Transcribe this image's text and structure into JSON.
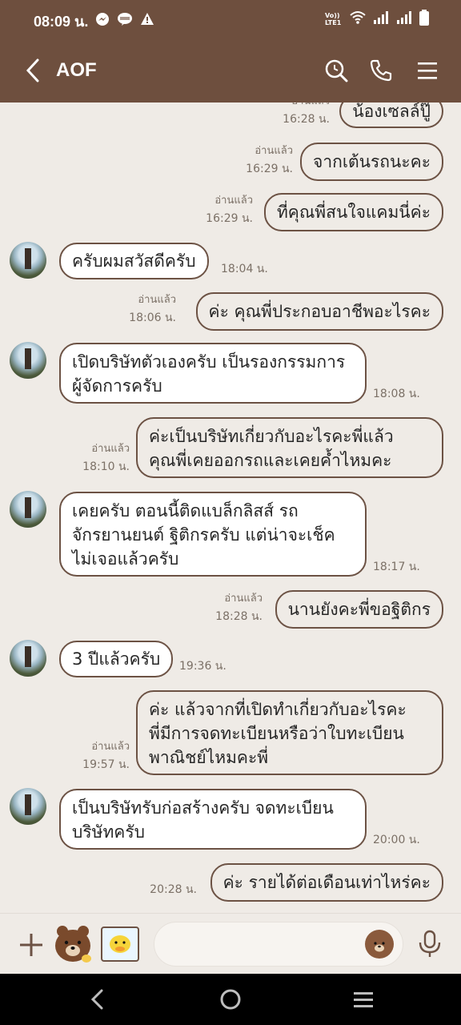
{
  "status_bar": {
    "time": "08:09 น.",
    "left_icons": [
      "messenger-icon",
      "line-icon",
      "warning-icon"
    ],
    "right_icons": [
      "volte-icon",
      "wifi-icon",
      "signal-icon",
      "signal-icon",
      "battery-icon"
    ],
    "volte_label": "Vo))\nLTE1"
  },
  "header": {
    "title": "AOF",
    "icons": [
      "back-icon",
      "search-icon",
      "phone-icon",
      "menu-icon"
    ]
  },
  "messages": [
    {
      "dir": "out",
      "text": "น้องเซลล์ปู๊",
      "time": "16:28 น.",
      "read": "อ่านแล้ว"
    },
    {
      "dir": "out",
      "text": "จากเต้นรถนะคะ",
      "time": "16:29 น.",
      "read": "อ่านแล้ว"
    },
    {
      "dir": "out",
      "text": "ที่คุณพี่สนใจแคมนี่ค่ะ",
      "time": "16:29 น.",
      "read": "อ่านแล้ว"
    },
    {
      "dir": "in",
      "text": "ครับผมสวัสดีครับ",
      "time": "18:04 น."
    },
    {
      "dir": "out",
      "text": "ค่ะ คุณพี่ประกอบอาชีพอะไรคะ",
      "time": "18:06 น.",
      "read": "อ่านแล้ว"
    },
    {
      "dir": "in",
      "lines": [
        "เปิดบริษัทตัวเองครับ เป็นรองกรรมการ",
        "ผู้จัดการครับ"
      ],
      "time": "18:08 น."
    },
    {
      "dir": "out",
      "lines": [
        "ค่ะเป็นบริษัทเกี่ยวกับอะไรคะพี่แล้ว",
        "คุณพี่เคยออกรถและเคยค้ำไหมคะ"
      ],
      "time": "18:10 น.",
      "read": "อ่านแล้ว"
    },
    {
      "dir": "in",
      "lines": [
        "เคยครับ ตอนนี้ติดแบล็กลิสส์ รถ",
        "จักรยานยนต์ ฐิติกรครับ แต่น่าจะเช็ค",
        "ไม่เจอแล้วครับ"
      ],
      "time": "18:17 น."
    },
    {
      "dir": "out",
      "text": "นานยังคะพี่ขอฐิติกร",
      "time": "18:28 น.",
      "read": "อ่านแล้ว"
    },
    {
      "dir": "in",
      "text": "3 ปีแล้วครับ",
      "time": "19:36 น."
    },
    {
      "dir": "out",
      "lines": [
        "ค่ะ แล้วจากที่เปิดทำเกี่ยวกับอะไรคะ",
        "พี่มีการจดทะเบียนหรือว่าใบทะเบียน",
        "พาณิชย์ไหมคะพี่"
      ],
      "time": "19:57 น.",
      "read": "อ่านแล้ว"
    },
    {
      "dir": "in",
      "lines": [
        "เป็นบริษัทรับก่อสร้างครับ จดทะเบียน",
        "บริษัทครับ"
      ],
      "time": "20:00 น."
    },
    {
      "dir": "out",
      "text": "ค่ะ รายได้ต่อเดือนเท่าไหร่คะ",
      "time": "20:28 น."
    }
  ],
  "input_bar": {
    "placeholder": "",
    "icons": [
      "plus-icon",
      "brown-bear-sticker",
      "sally-sticker",
      "emoji-icon",
      "mic-icon"
    ]
  },
  "nav_bar": {
    "icons": [
      "nav-back-icon",
      "nav-home-icon",
      "nav-recents-icon"
    ]
  },
  "colors": {
    "header_bg": "#6e4f3e",
    "chat_bg": "#efebe6",
    "bubble_border": "#6c5244",
    "bubble_in_bg": "#ffffff",
    "bubble_out_bg": "#efebe6",
    "meta_text": "#7b7066"
  }
}
